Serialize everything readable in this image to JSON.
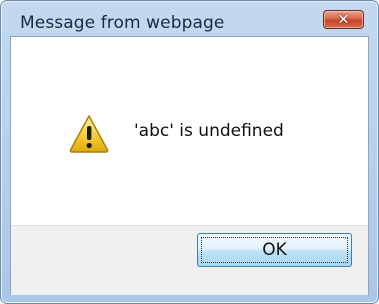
{
  "dialog": {
    "title": "Message from webpage",
    "close_glyph": "✕",
    "message": "'abc' is undefined",
    "icon": "warning-icon",
    "ok_label": "OK"
  },
  "colors": {
    "frame": "#b9d2ee",
    "close_button": "#d8664c",
    "ok_button": "#bfe1f6",
    "warning_yellow": "#f7d23c"
  }
}
